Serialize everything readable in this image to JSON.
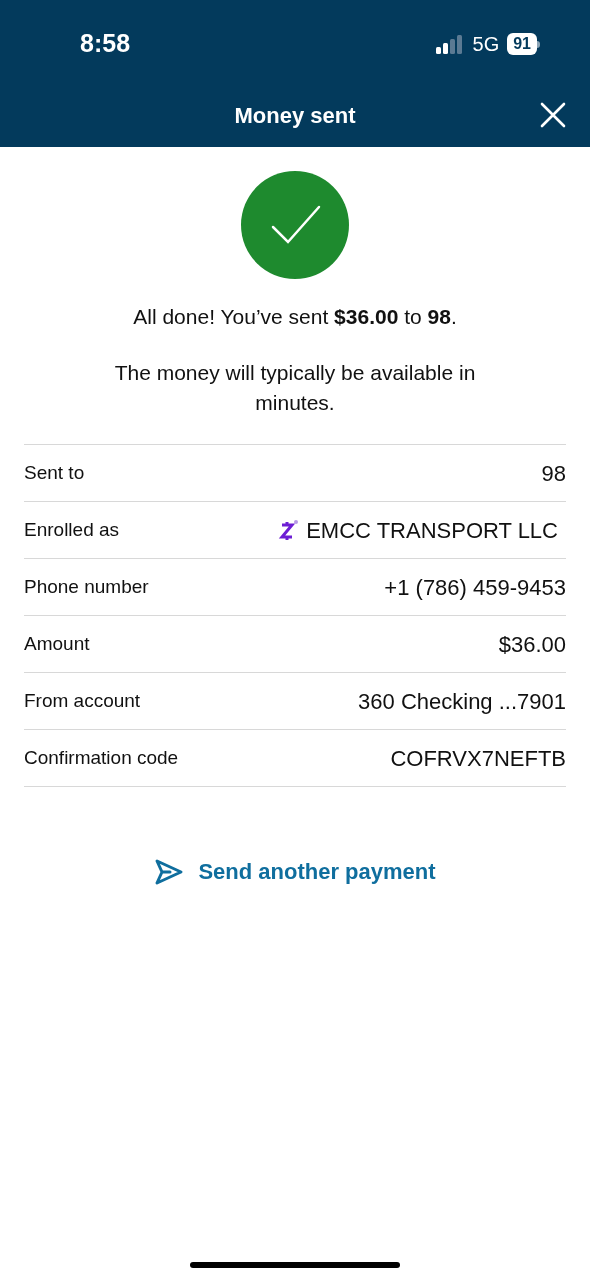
{
  "status_bar": {
    "time": "8:58",
    "network": "5G",
    "battery": "91"
  },
  "header": {
    "title": "Money sent"
  },
  "messages": [
    "All done! You’ve sent **$36.00** to **98**.",
    "The money will typically be available in minutes."
  ],
  "details": [
    {
      "kind": "plain",
      "label": "Sent to",
      "value": "98"
    },
    {
      "kind": "zelle",
      "label": "Enrolled as",
      "value": "EMCC TRANSPORT LLC"
    },
    {
      "kind": "plain",
      "label": "Phone number",
      "value": "+1 (786) 459-9453"
    },
    {
      "kind": "plain",
      "label": "Amount",
      "value": "$36.00"
    },
    {
      "kind": "plain",
      "label": "From account",
      "value": "360 Checking ...7901"
    },
    {
      "kind": "plain",
      "label": "Confirmation code",
      "value": "COFRVX7NEFTB"
    }
  ],
  "action": {
    "label": "Send another payment"
  }
}
